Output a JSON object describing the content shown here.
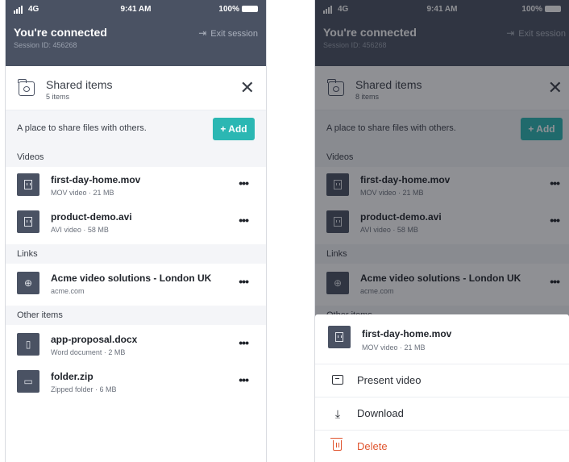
{
  "status_bar": {
    "network": "4G",
    "time": "9:41 AM",
    "battery": "100%"
  },
  "session": {
    "title": "You're connected",
    "id_label": "Session ID: 456268",
    "exit_label": "Exit session"
  },
  "sheet_left": {
    "title": "Shared items",
    "count": "5 items"
  },
  "sheet_right": {
    "title": "Shared items",
    "count": "8 items"
  },
  "description": "A place to share files with others.",
  "add_label": "+ Add",
  "sections": {
    "videos": "Videos",
    "links": "Links",
    "other": "Other items",
    "other_cut": "Other items"
  },
  "items": {
    "video1": {
      "name": "first-day-home.mov",
      "meta": "MOV video  ·  21 MB"
    },
    "video2": {
      "name": "product-demo.avi",
      "meta": "AVI video  ·  58 MB"
    },
    "link1": {
      "name": "Acme video solutions - London UK",
      "meta": "acme.com"
    },
    "doc1": {
      "name": "app-proposal.docx",
      "meta": "Word document  ·  2 MB"
    },
    "zip1": {
      "name": "folder.zip",
      "meta": "Zipped folder  ·  6 MB"
    }
  },
  "menu": {
    "file": {
      "name": "first-day-home.mov",
      "meta": "MOV video  ·  21 MB"
    },
    "present": "Present video",
    "download": "Download",
    "delete": "Delete"
  },
  "more_glyph": "•••",
  "colors": {
    "header": "#4a5263",
    "accent": "#2bb7b3",
    "danger": "#e0552f",
    "section_bg": "#f4f5f8"
  },
  "icons": [
    "signal-icon",
    "wifi-icon",
    "battery-icon",
    "exit-icon",
    "folder-icon",
    "close-icon",
    "video-file-icon",
    "globe-icon",
    "document-icon",
    "zip-folder-icon",
    "more-icon",
    "present-icon",
    "download-icon",
    "trash-icon"
  ]
}
